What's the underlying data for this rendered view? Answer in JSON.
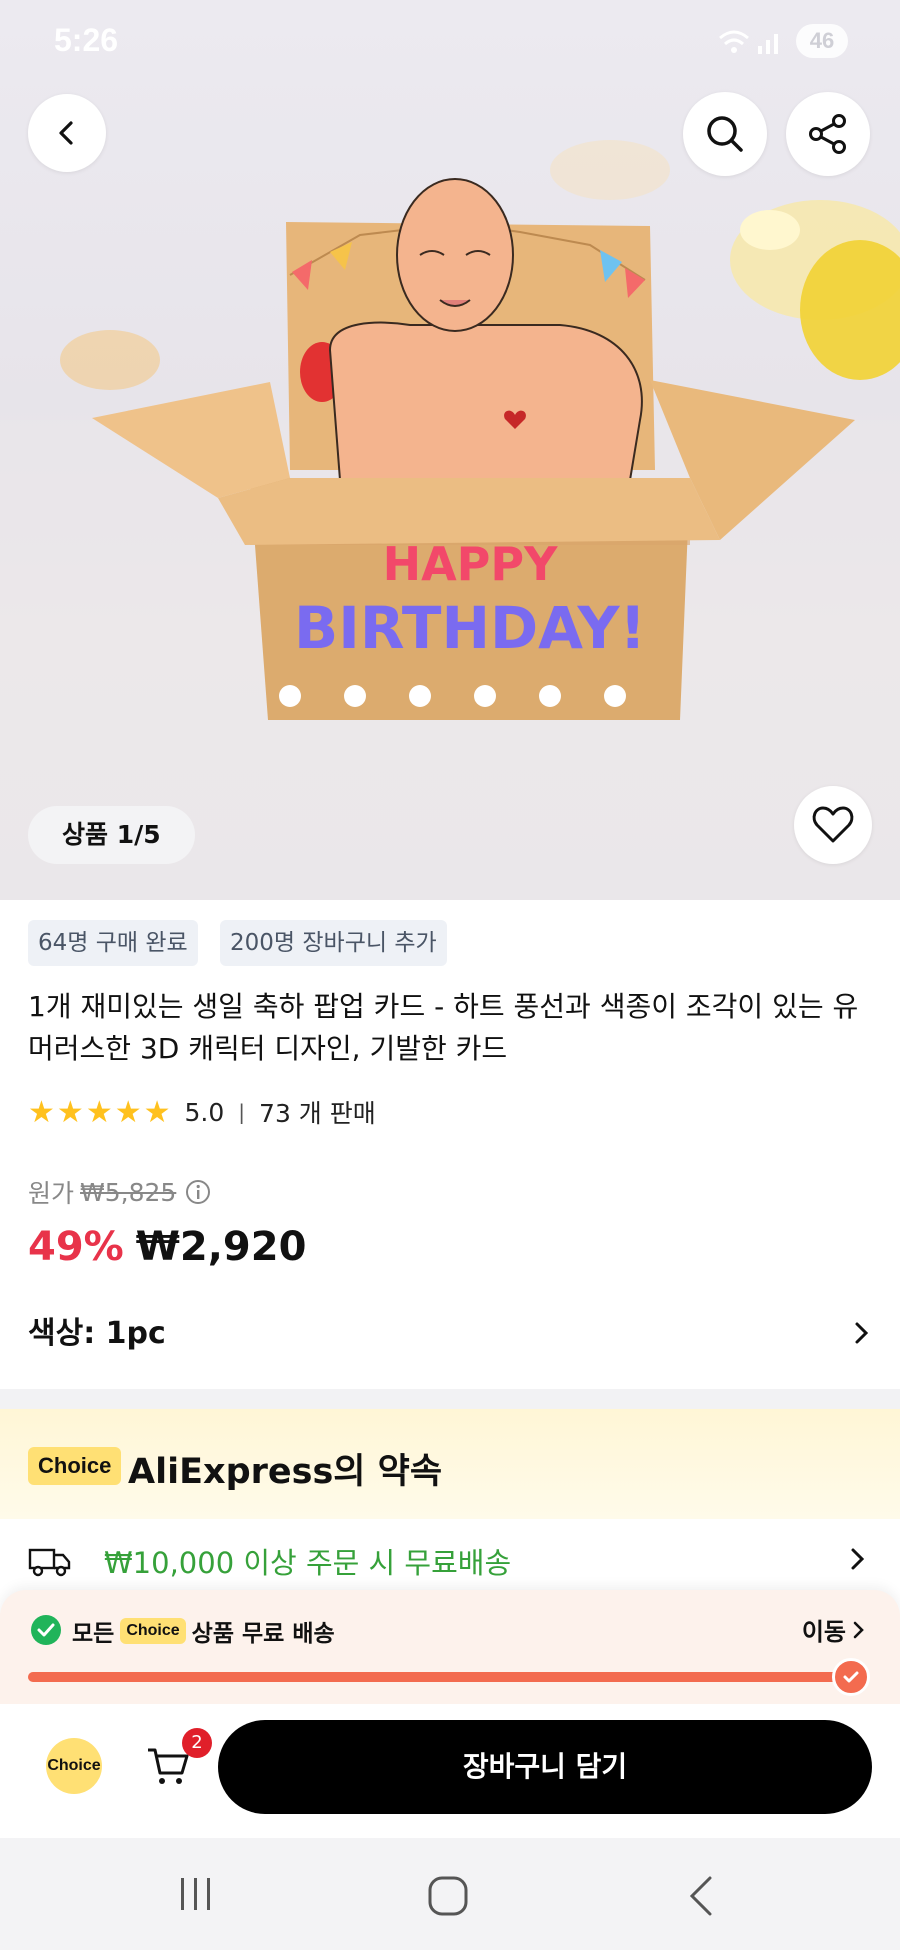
{
  "status_bar": {
    "time": "5:26",
    "battery": "46"
  },
  "gallery": {
    "counter": "상품 1/5"
  },
  "product_image": {
    "art_text_line1": "HAPPY",
    "art_text_line2": "BIRTHDAY!"
  },
  "stats": {
    "purchased": "64명 구매 완료",
    "carted": "200명 장바구니 추가"
  },
  "product": {
    "title": "1개 재미있는 생일 축하 팝업 카드 - 하트 풍선과 색종이 조각이 있는 유머러스한 3D 캐릭터 디자인, 기발한 카드",
    "rating": "5.0",
    "stars": 5,
    "sold": "73 개 판매",
    "original_label": "원가",
    "original_price": "₩5,825",
    "discount": "49%",
    "price": "₩2,920",
    "option": "색상: 1pc"
  },
  "promise": {
    "choice_badge": "Choice",
    "title": "AliExpress의 약속"
  },
  "shipping": {
    "text": "₩10,000 이상 주문 시 무료배송"
  },
  "free_shipping_bar": {
    "prefix": "모든",
    "choice_badge": "Choice",
    "suffix": "상품 무료 배송",
    "go": "이동",
    "progress": 1.0
  },
  "bottom_bar": {
    "choice_label": "Choice",
    "cart_count": "2",
    "add_to_cart": "장바구니 담기"
  },
  "colors": {
    "accent_red": "#e8334a",
    "green": "#36a13a",
    "star": "#ffc11e",
    "choice_yellow": "#ffe074"
  }
}
